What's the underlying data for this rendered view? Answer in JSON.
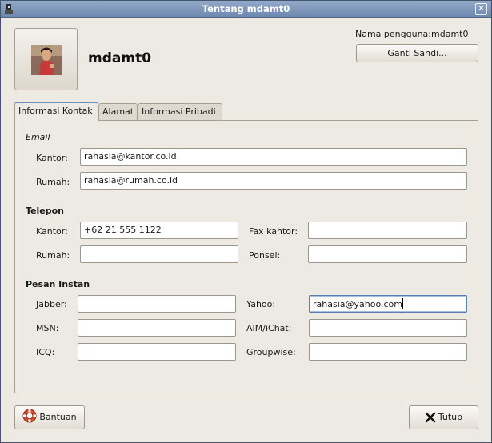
{
  "window": {
    "title": "Tentang mdamt0",
    "close_glyph": "✕"
  },
  "header": {
    "display_name": "mdamt0",
    "username_label": "Nama pengguna:",
    "username_value": "mdamt0",
    "change_password_label": "Ganti Sandi..."
  },
  "tabs": [
    {
      "label": "Informasi Kontak",
      "active": true
    },
    {
      "label": "Alamat",
      "active": false
    },
    {
      "label": "Informasi Pribadi",
      "active": false
    }
  ],
  "contact": {
    "email_heading": "Email",
    "email_work_label": "Kantor:",
    "email_work_value": "rahasia@kantor.co.id",
    "email_home_label": "Rumah:",
    "email_home_value": "rahasia@rumah.co.id",
    "phone_heading": "Telepon",
    "phone_work_label": "Kantor:",
    "phone_work_value": "+62 21 555 1122",
    "phone_home_label": "Rumah:",
    "phone_home_value": "",
    "fax_label": "Fax kantor:",
    "fax_value": "",
    "mobile_label": "Ponsel:",
    "mobile_value": "",
    "im_heading": "Pesan Instan",
    "jabber_label": "Jabber:",
    "jabber_value": "",
    "msn_label": "MSN:",
    "msn_value": "",
    "icq_label": "ICQ:",
    "icq_value": "",
    "yahoo_label": "Yahoo:",
    "yahoo_value": "rahasia@yahoo.com",
    "aim_label": "AIM/iChat:",
    "aim_value": "",
    "groupwise_label": "Groupwise:",
    "groupwise_value": ""
  },
  "footer": {
    "help_label": "Bantuan",
    "close_label": "Tutup"
  },
  "colors": {
    "titlebar": "#7f97bb",
    "window_bg": "#ede9e3",
    "focus_border": "#5a7fb5"
  },
  "icons": {
    "window": "user-info-icon",
    "help": "lifebuoy-icon",
    "close": "close-x-icon"
  }
}
